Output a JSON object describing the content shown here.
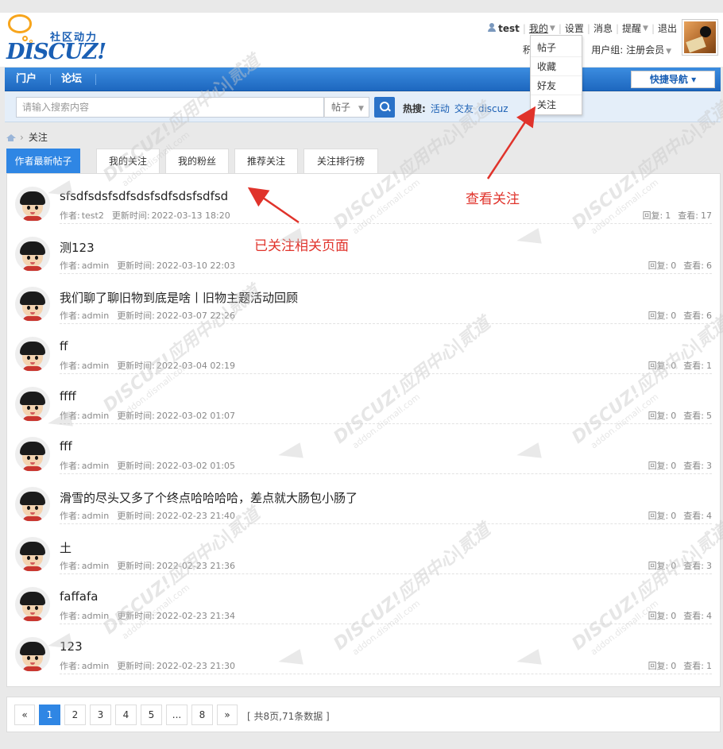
{
  "logo": {
    "subtitle": "社区动力",
    "wordmark": "DISCUZ!"
  },
  "userbar": {
    "username": "test",
    "my": "我的",
    "settings": "设置",
    "messages": "消息",
    "reminders": "提醒",
    "logout": "退出",
    "points_trunc": "积",
    "usergroup": "用户组: 注册会员"
  },
  "dropdown": {
    "items": [
      "帖子",
      "收藏",
      "好友",
      "关注"
    ]
  },
  "nav": {
    "portal": "门户",
    "forum": "论坛",
    "quicknav": "快捷导航 ▾"
  },
  "search": {
    "placeholder": "请输入搜索内容",
    "type": "帖子",
    "hot_label": "热搜:",
    "hot_words": [
      "活动",
      "交友",
      "discuz"
    ]
  },
  "breadcrumb": {
    "current": "关注",
    "sep": "›"
  },
  "tabs": [
    "作者最新帖子",
    "我的关注",
    "我的粉丝",
    "推荐关注",
    "关注排行榜"
  ],
  "labels": {
    "author": "作者:",
    "updated": "更新时间:",
    "replies": "回复:",
    "views": "查看:"
  },
  "posts": [
    {
      "title": "sfsdfsdsfsdfsdsfsdfsdsfsdfsd",
      "author": "test2",
      "time": "2022-03-13 18:20",
      "replies": "1",
      "views": "17"
    },
    {
      "title": "测123",
      "author": "admin",
      "time": "2022-03-10 22:03",
      "replies": "0",
      "views": "6"
    },
    {
      "title": "我们聊了聊旧物到底是啥丨旧物主题活动回顾",
      "author": "admin",
      "time": "2022-03-07 22:26",
      "replies": "0",
      "views": "6"
    },
    {
      "title": "ff",
      "author": "admin",
      "time": "2022-03-04 02:19",
      "replies": "0",
      "views": "1"
    },
    {
      "title": "ffff",
      "author": "admin",
      "time": "2022-03-02 01:07",
      "replies": "0",
      "views": "5"
    },
    {
      "title": "fff",
      "author": "admin",
      "time": "2022-03-02 01:05",
      "replies": "0",
      "views": "3"
    },
    {
      "title": "滑雪的尽头又多了个终点哈哈哈哈，差点就大肠包小肠了",
      "author": "admin",
      "time": "2022-02-23 21:40",
      "replies": "0",
      "views": "4"
    },
    {
      "title": "土",
      "author": "admin",
      "time": "2022-02-23 21:36",
      "replies": "0",
      "views": "3"
    },
    {
      "title": "faffafa",
      "author": "admin",
      "time": "2022-02-23 21:34",
      "replies": "0",
      "views": "4"
    },
    {
      "title": "123",
      "author": "admin",
      "time": "2022-02-23 21:30",
      "replies": "0",
      "views": "1"
    }
  ],
  "pagination": {
    "prev": "«",
    "pages": [
      "1",
      "2",
      "3",
      "4",
      "5",
      "...",
      "8"
    ],
    "next": "»",
    "info": "[ 共8页,71条数据 ]"
  },
  "annotations": {
    "view_follow": "查看关注",
    "followed_page": "已关注相关页面"
  },
  "watermark": {
    "brand": "DISCUZ!应用中心|贰道",
    "domain": "addon.dismall.com"
  },
  "colors": {
    "accent": "#2f86e4",
    "nav": "#1d67bf",
    "annotation": "#e0332b",
    "link": "#1a5fb4"
  }
}
